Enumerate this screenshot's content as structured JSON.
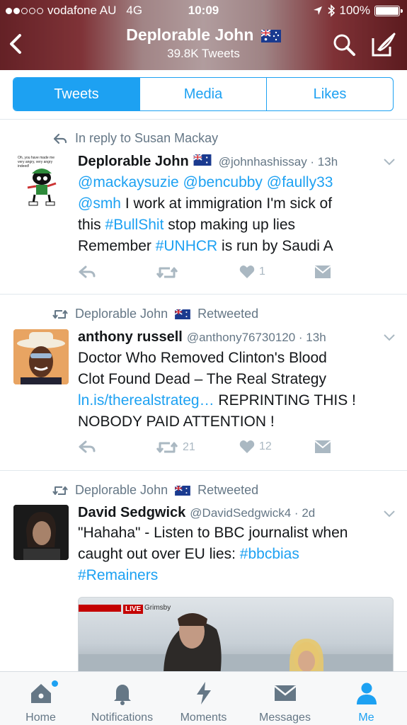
{
  "status": {
    "carrier": "vodafone AU",
    "network": "4G",
    "time": "10:09",
    "battery": "100%"
  },
  "header": {
    "title": "Deplorable John",
    "subtitle": "39.8K Tweets"
  },
  "tabs": [
    "Tweets",
    "Media",
    "Likes"
  ],
  "tweets": [
    {
      "context": "In reply to Susan Mackay",
      "name": "Deplorable John",
      "handle": "@johnhashissay · 13h",
      "mentions": "@mackaysuzie @bencubby @faully33",
      "line2_link": "@smh",
      "line2_text": " I work at immigration I'm sick of",
      "line3_text_a": "this ",
      "line3_link": "#BullShit",
      "line3_text_b": " stop making up lies",
      "line4_text_a": "Remember ",
      "line4_link": "#UNHCR",
      "line4_text_b": " is run by Saudi A",
      "retweets": "",
      "likes": "1"
    },
    {
      "context_name": "Deplorable John",
      "context_suffix": "Retweeted",
      "name": "anthony russell",
      "handle": "@anthony76730120 · 13h",
      "line1": "Doctor Who Removed Clinton's Blood",
      "line2": "Clot Found Dead – The Real Strategy",
      "line3_link": "ln.is/therealstrateg…",
      "line3_text": " REPRINTING THIS !",
      "line4": "NOBODY PAID ATTENTION !",
      "retweets": "21",
      "likes": "12"
    },
    {
      "context_name": "Deplorable John",
      "context_suffix": "Retweeted",
      "name": "David Sedgwick",
      "handle": "@DavidSedgwick4 · 2d",
      "line1": "\"Hahaha\" - Listen to BBC journalist when",
      "line2_text": "caught out over EU lies: ",
      "line2_link": "#bbcbias",
      "line3_link": "#Remainers",
      "media_live": "LIVE",
      "media_place": "Grimsby"
    }
  ],
  "tabbar": [
    "Home",
    "Notifications",
    "Moments",
    "Messages",
    "Me"
  ],
  "colors": {
    "accent": "#1da1f2",
    "muted": "#657786",
    "icon": "#aab8c2"
  }
}
